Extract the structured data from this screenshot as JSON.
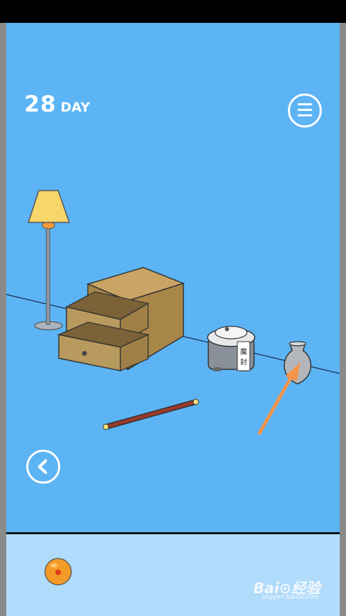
{
  "hud": {
    "day_number": "28",
    "day_label": "DAY"
  },
  "scene": {
    "objects": [
      "floor-lamp",
      "open-drawer-cabinet",
      "rice-cooker",
      "ceramic-vase",
      "wooden-stick"
    ],
    "cooker_seal_text": "魔封",
    "hint_arrow_color": "#f4944a",
    "background_color": "#5cb4f5"
  },
  "inventory": {
    "items": [
      "dragon-ball"
    ],
    "background_color": "#b0dbfb"
  },
  "watermark": {
    "logo_text": "Bai⊙经验",
    "sub_text": "jingyan.baidu.com"
  },
  "icons": {
    "menu": "hamburger-icon",
    "back": "chevron-left-icon"
  }
}
